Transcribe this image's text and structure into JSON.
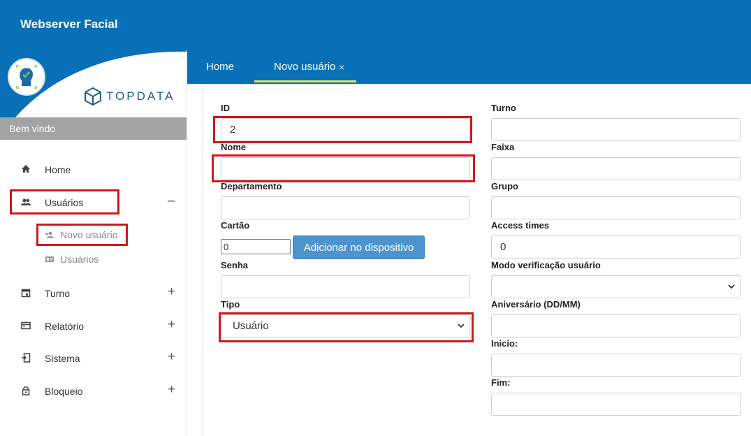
{
  "app": {
    "title": "Webserver Facial"
  },
  "brand": {
    "name": "TOPDATA"
  },
  "sidebar": {
    "welcome": "Bem vindo",
    "items": [
      {
        "label": "Home",
        "icon": "home-icon",
        "toggle": ""
      },
      {
        "label": "Usuários",
        "icon": "users-icon",
        "toggle": "–"
      },
      {
        "label": "Turno",
        "icon": "calendar-icon",
        "toggle": "+"
      },
      {
        "label": "Relatório",
        "icon": "report-icon",
        "toggle": "+"
      },
      {
        "label": "Sistema",
        "icon": "system-icon",
        "toggle": "+"
      },
      {
        "label": "Bloqueio",
        "icon": "lock-icon",
        "toggle": "+"
      }
    ],
    "subitems": [
      {
        "label": "Novo usuário",
        "icon": "add-user-icon"
      },
      {
        "label": "Usuários",
        "icon": "id-card-icon"
      }
    ]
  },
  "tabs": [
    {
      "label": "Home",
      "active": false
    },
    {
      "label": "Novo usuário",
      "active": true,
      "close": "×"
    }
  ],
  "form": {
    "id": {
      "label": "ID",
      "value": "2"
    },
    "nome": {
      "label": "Nome",
      "value": ""
    },
    "departamento": {
      "label": "Departamento",
      "value": ""
    },
    "cartao": {
      "label": "Cartão",
      "value": "0"
    },
    "adicionar_button": "Adicionar no dispositivo",
    "senha": {
      "label": "Senha",
      "value": ""
    },
    "tipo": {
      "label": "Tipo",
      "value": "Usuário"
    },
    "turno": {
      "label": "Turno",
      "value": ""
    },
    "faixa": {
      "label": "Faixa",
      "value": ""
    },
    "grupo": {
      "label": "Grupo",
      "value": ""
    },
    "access_times": {
      "label": "Access times",
      "value": "0"
    },
    "modo_verificacao": {
      "label": "Modo verificação usuário",
      "value": ""
    },
    "aniversario": {
      "label": "Aniversário (DD/MM)",
      "value": ""
    },
    "inicio": {
      "label": "Inicio:",
      "value": ""
    },
    "fim": {
      "label": "Fim:",
      "value": ""
    }
  },
  "colors": {
    "primary": "#0770b7",
    "highlight": "#d0171d",
    "button": "#4d93cf",
    "tab_underline": "#dfe560"
  }
}
